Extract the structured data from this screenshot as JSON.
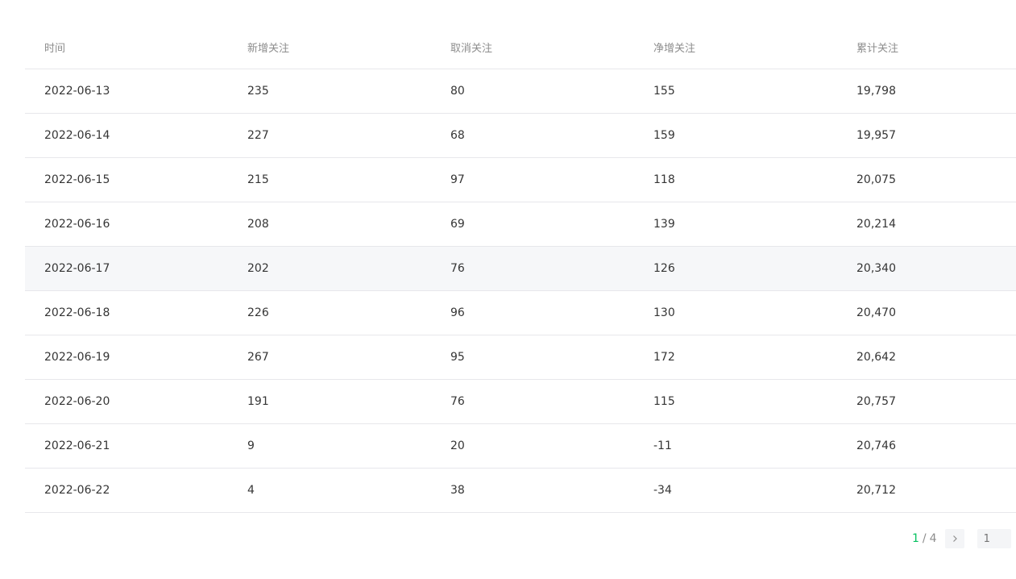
{
  "table": {
    "headers": [
      "时间",
      "新增关注",
      "取消关注",
      "净增关注",
      "累计关注"
    ],
    "rows": [
      [
        "2022-06-13",
        "235",
        "80",
        "155",
        "19,798"
      ],
      [
        "2022-06-14",
        "227",
        "68",
        "159",
        "19,957"
      ],
      [
        "2022-06-15",
        "215",
        "97",
        "118",
        "20,075"
      ],
      [
        "2022-06-16",
        "208",
        "69",
        "139",
        "20,214"
      ],
      [
        "2022-06-17",
        "202",
        "76",
        "126",
        "20,340"
      ],
      [
        "2022-06-18",
        "226",
        "96",
        "130",
        "20,470"
      ],
      [
        "2022-06-19",
        "267",
        "95",
        "172",
        "20,642"
      ],
      [
        "2022-06-20",
        "191",
        "76",
        "115",
        "20,757"
      ],
      [
        "2022-06-21",
        "9",
        "20",
        "-11",
        "20,746"
      ],
      [
        "2022-06-22",
        "4",
        "38",
        "-34",
        "20,712"
      ]
    ],
    "hovered_row": 4
  },
  "pagination": {
    "current": "1",
    "separator": "/",
    "total": "4",
    "next_icon": "chevron-right-icon",
    "goto_placeholder": "1"
  },
  "colors": {
    "accent": "#07c160",
    "border": "#e7e7eb",
    "header_text": "#8d8d8d",
    "hover_bg": "#f6f7f9"
  }
}
